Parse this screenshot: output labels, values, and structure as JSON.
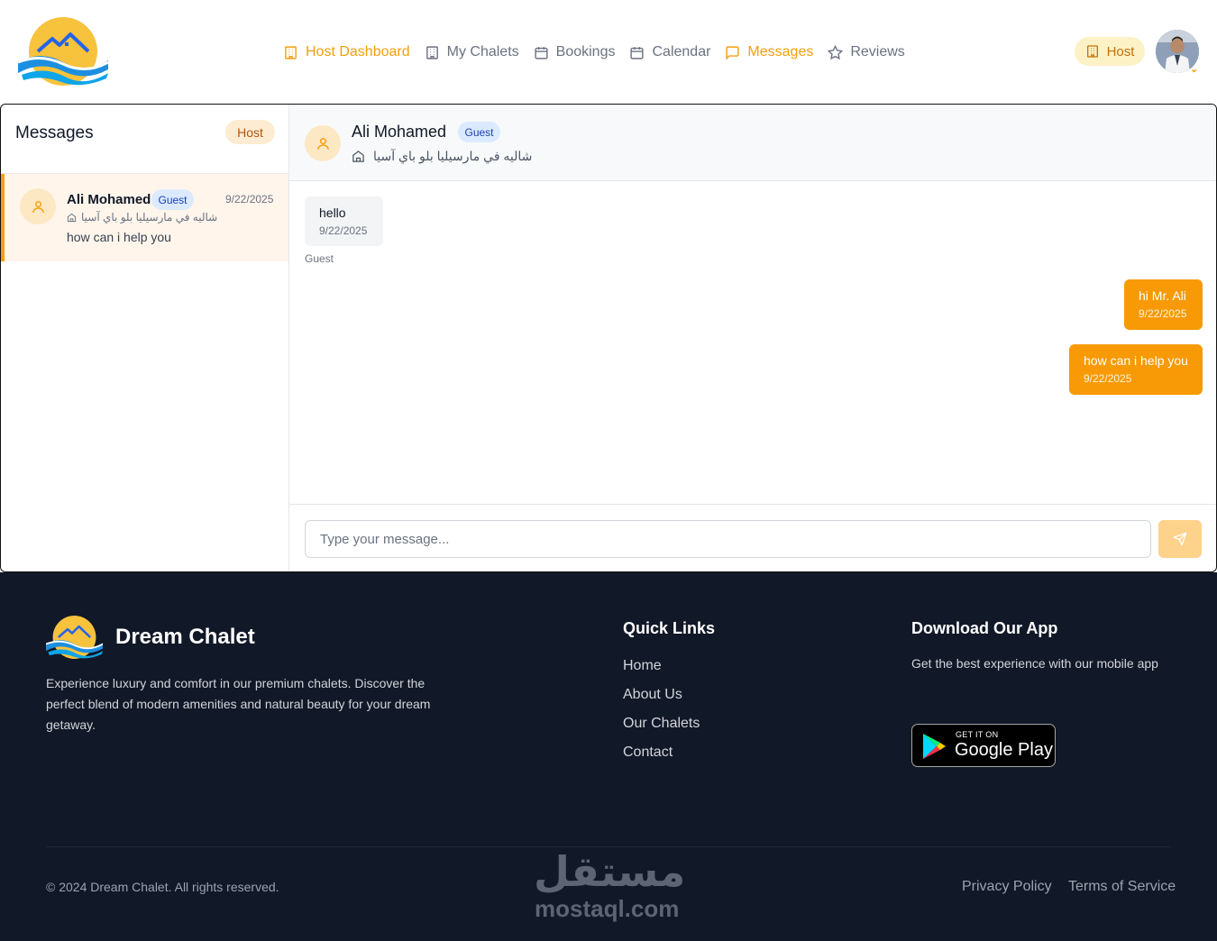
{
  "header": {
    "nav": [
      {
        "label": "Host Dashboard",
        "icon": "building-icon",
        "active": true
      },
      {
        "label": "My Chalets",
        "icon": "building-icon",
        "active": false
      },
      {
        "label": "Bookings",
        "icon": "calendar-icon",
        "active": false
      },
      {
        "label": "Calendar",
        "icon": "calendar-icon",
        "active": false
      },
      {
        "label": "Messages",
        "icon": "message-icon",
        "active": true
      },
      {
        "label": "Reviews",
        "icon": "star-icon",
        "active": false
      }
    ],
    "role_label": "Host"
  },
  "sidebar": {
    "title": "Messages",
    "badge": "Host",
    "conversations": [
      {
        "name": "Ali Mohamed",
        "role": "Guest",
        "date": "9/22/2025",
        "chalet": "شاليه في مارسيليا بلو باي آسيا",
        "last_message": "how can i help you"
      }
    ]
  },
  "chat": {
    "name": "Ali Mohamed",
    "role": "Guest",
    "chalet": "شاليه في مارسيليا بلو باي آسيا",
    "messages": [
      {
        "text": "hello",
        "time": "9/22/2025",
        "direction": "incoming",
        "sender": "Guest"
      },
      {
        "text": "hi Mr. Ali",
        "time": "9/22/2025",
        "direction": "outgoing"
      },
      {
        "text": "how can i help you",
        "time": "9/22/2025",
        "direction": "outgoing"
      }
    ],
    "input_placeholder": "Type your message..."
  },
  "footer": {
    "brand": "Dream Chalet",
    "description": "Experience luxury and comfort in our premium chalets. Discover the perfect blend of modern amenities and natural beauty for your dream getaway.",
    "quick_links_title": "Quick Links",
    "quick_links": [
      "Home",
      "About Us",
      "Our Chalets",
      "Contact"
    ],
    "app_title": "Download Our App",
    "app_description": "Get the best experience with our mobile app",
    "google_play_small": "GET IT ON",
    "google_play_big": "Google Play",
    "copyright": "© 2024 Dream Chalet. All rights reserved.",
    "privacy": "Privacy Policy",
    "terms": "Terms of Service",
    "watermark_ar": "مستقل",
    "watermark_en": "mostaql.com"
  },
  "colors": {
    "accent": "#f59e0b",
    "footer_bg": "#111827",
    "outgoing_bubble": "#f79a05"
  }
}
